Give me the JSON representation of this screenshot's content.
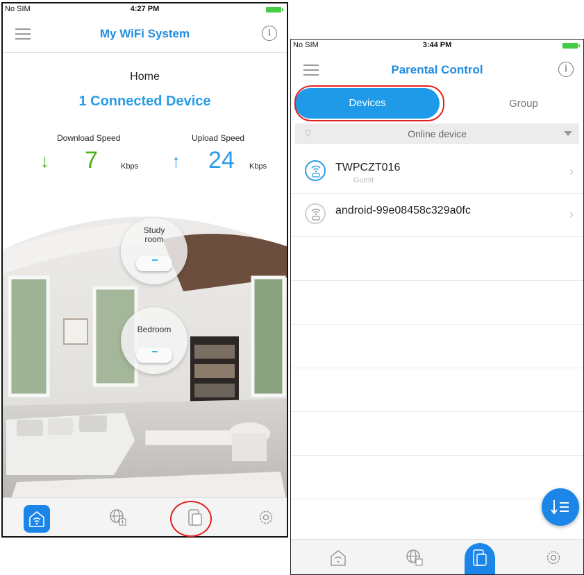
{
  "left_phone": {
    "status": {
      "carrier": "No SIM",
      "time": "4:27 PM"
    },
    "title": "My WiFi System",
    "location": "Home",
    "connected": "1 Connected Device",
    "download": {
      "label": "Download Speed",
      "value": "7",
      "unit": "Kbps"
    },
    "upload": {
      "label": "Upload Speed",
      "value": "24",
      "unit": "Kbps"
    },
    "nodes": [
      {
        "label": "Study room"
      },
      {
        "label": "Bedroom"
      }
    ],
    "tabs": [
      "home-icon",
      "globe-icon",
      "devices-icon",
      "settings-icon"
    ]
  },
  "right_phone": {
    "status": {
      "carrier": "No SIM",
      "time": "3:44 PM"
    },
    "title": "Parental Control",
    "segments": {
      "devices": "Devices",
      "group": "Group"
    },
    "filter": "Online device",
    "devices": [
      {
        "name": "TWPCZT016",
        "sub": "Guest"
      },
      {
        "name": "android-99e08458c329a0fc",
        "sub": ""
      }
    ],
    "tabs": [
      "home-icon",
      "globe-icon",
      "devices-icon",
      "settings-icon"
    ]
  },
  "colors": {
    "accent": "#1f8ce0",
    "download": "#4caf1f",
    "upload": "#2a9be6",
    "highlight": "#e02020"
  }
}
